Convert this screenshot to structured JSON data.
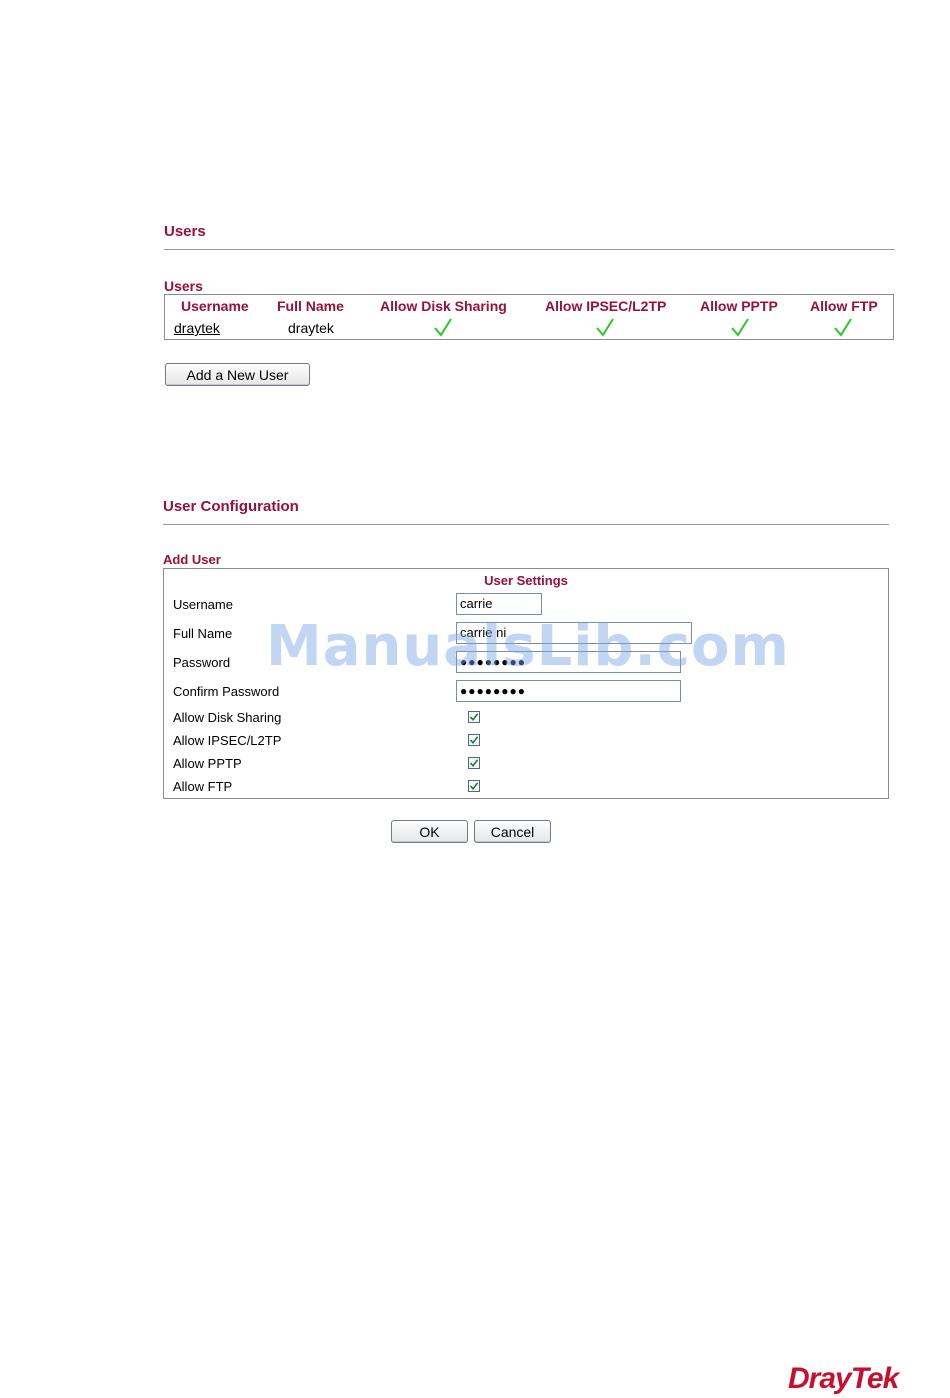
{
  "users_section": {
    "title": "Users",
    "table_label": "Users",
    "columns": [
      "Username",
      "Full Name",
      "Allow Disk Sharing",
      "Allow IPSEC/L2TP",
      "Allow PPTP",
      "Allow FTP"
    ],
    "rows": [
      {
        "username": "draytek",
        "full_name": "draytek",
        "disk_sharing": true,
        "ipsec_l2tp": true,
        "pptp": true,
        "ftp": true
      }
    ],
    "add_button": "Add a New User"
  },
  "config_section": {
    "title": "User Configuration",
    "box_label": "Add User",
    "settings_heading": "User Settings",
    "fields": {
      "username_label": "Username",
      "username_value": "carrie",
      "fullname_label": "Full Name",
      "fullname_value": "carrie ni",
      "password_label": "Password",
      "password_value": "●●●●●●●●",
      "confirm_label": "Confirm Password",
      "confirm_value": "●●●●●●●●"
    },
    "options": [
      {
        "label": "Allow Disk Sharing",
        "checked": true
      },
      {
        "label": "Allow IPSEC/L2TP",
        "checked": true
      },
      {
        "label": "Allow PPTP",
        "checked": true
      },
      {
        "label": "Allow FTP",
        "checked": true
      }
    ],
    "ok_button": "OK",
    "cancel_button": "Cancel"
  },
  "watermark": "ManualsLib.com",
  "brand_logo": "DrayTek",
  "colors": {
    "accent": "#99103a",
    "check": "#22cc22",
    "brand": "#c8102e"
  }
}
